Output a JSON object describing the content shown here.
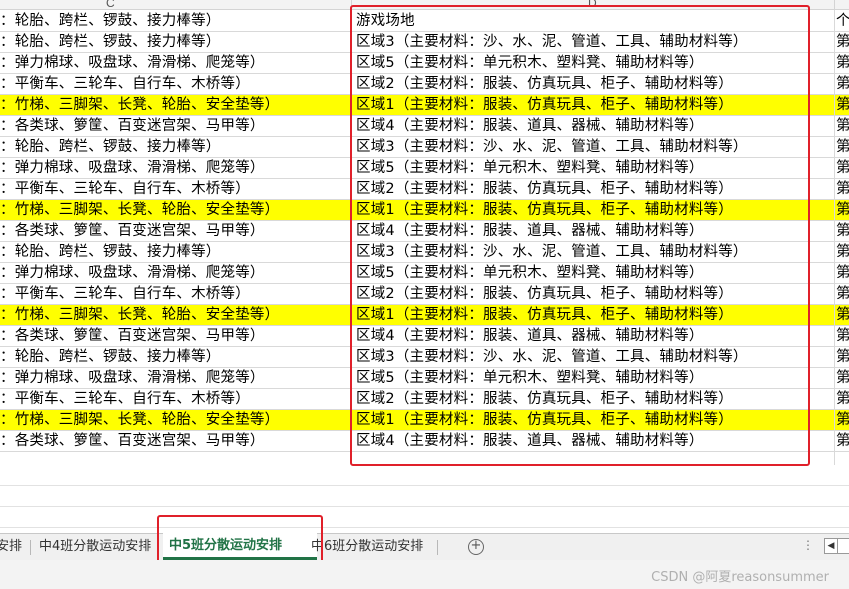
{
  "columns": {
    "c": "C",
    "d": "D"
  },
  "rows": [
    {
      "c": "：轮胎、跨栏、锣鼓、接力棒等）",
      "d": "游戏场地",
      "e": "个",
      "highlight": false
    },
    {
      "c": "：轮胎、跨栏、锣鼓、接力棒等）",
      "d": "区域3（主要材料：沙、水、泥、管道、工具、辅助材料等）",
      "e": "第",
      "highlight": false
    },
    {
      "c": "：弹力棉球、吸盘球、滑滑梯、爬笼等）",
      "d": "区域5（主要材料：单元积木、塑料凳、辅助材料等）",
      "e": "第",
      "highlight": false
    },
    {
      "c": "：平衡车、三轮车、自行车、木桥等）",
      "d": "区域2（主要材料：服装、仿真玩具、柜子、辅助材料等）",
      "e": "第",
      "highlight": false
    },
    {
      "c": "：竹梯、三脚架、长凳、轮胎、安全垫等）",
      "d": "区域1（主要材料：服装、仿真玩具、柜子、辅助材料等）",
      "e": "第",
      "highlight": true
    },
    {
      "c": "：各类球、箩筐、百变迷宫架、马甲等）",
      "d": "区域4（主要材料：服装、道具、器械、辅助材料等）",
      "e": "第",
      "highlight": false
    },
    {
      "c": "：轮胎、跨栏、锣鼓、接力棒等）",
      "d": "区域3（主要材料：沙、水、泥、管道、工具、辅助材料等）",
      "e": "第",
      "highlight": false
    },
    {
      "c": "：弹力棉球、吸盘球、滑滑梯、爬笼等）",
      "d": "区域5（主要材料：单元积木、塑料凳、辅助材料等）",
      "e": "第",
      "highlight": false
    },
    {
      "c": "：平衡车、三轮车、自行车、木桥等）",
      "d": "区域2（主要材料：服装、仿真玩具、柜子、辅助材料等）",
      "e": "第",
      "highlight": false
    },
    {
      "c": "：竹梯、三脚架、长凳、轮胎、安全垫等）",
      "d": "区域1（主要材料：服装、仿真玩具、柜子、辅助材料等）",
      "e": "第",
      "highlight": true
    },
    {
      "c": "：各类球、箩筐、百变迷宫架、马甲等）",
      "d": "区域4（主要材料：服装、道具、器械、辅助材料等）",
      "e": "第",
      "highlight": false
    },
    {
      "c": "：轮胎、跨栏、锣鼓、接力棒等）",
      "d": "区域3（主要材料：沙、水、泥、管道、工具、辅助材料等）",
      "e": "第",
      "highlight": false
    },
    {
      "c": "：弹力棉球、吸盘球、滑滑梯、爬笼等）",
      "d": "区域5（主要材料：单元积木、塑料凳、辅助材料等）",
      "e": "第",
      "highlight": false
    },
    {
      "c": "：平衡车、三轮车、自行车、木桥等）",
      "d": "区域2（主要材料：服装、仿真玩具、柜子、辅助材料等）",
      "e": "第",
      "highlight": false
    },
    {
      "c": "：竹梯、三脚架、长凳、轮胎、安全垫等）",
      "d": "区域1（主要材料：服装、仿真玩具、柜子、辅助材料等）",
      "e": "第",
      "highlight": true
    },
    {
      "c": "：各类球、箩筐、百变迷宫架、马甲等）",
      "d": "区域4（主要材料：服装、道具、器械、辅助材料等）",
      "e": "第",
      "highlight": false
    },
    {
      "c": "：轮胎、跨栏、锣鼓、接力棒等）",
      "d": "区域3（主要材料：沙、水、泥、管道、工具、辅助材料等）",
      "e": "第",
      "highlight": false
    },
    {
      "c": "：弹力棉球、吸盘球、滑滑梯、爬笼等）",
      "d": "区域5（主要材料：单元积木、塑料凳、辅助材料等）",
      "e": "第",
      "highlight": false
    },
    {
      "c": "：平衡车、三轮车、自行车、木桥等）",
      "d": "区域2（主要材料：服装、仿真玩具、柜子、辅助材料等）",
      "e": "第",
      "highlight": false
    },
    {
      "c": "：竹梯、三脚架、长凳、轮胎、安全垫等）",
      "d": "区域1（主要材料：服装、仿真玩具、柜子、辅助材料等）",
      "e": "第",
      "highlight": true
    },
    {
      "c": "：各类球、箩筐、百变迷宫架、马甲等）",
      "d": "区域4（主要材料：服装、道具、器械、辅助材料等）",
      "e": "第",
      "highlight": false
    }
  ],
  "sheet_tabs": [
    {
      "label": "安排",
      "active": false
    },
    {
      "label": "中4班分散运动安排",
      "active": false
    },
    {
      "label": "中5班分散运动安排",
      "active": true
    },
    {
      "label": "中6班分散运动安排",
      "active": false
    }
  ],
  "add_sheet_icon": "plus-circle-icon",
  "more_icon": "ellipsis-icon",
  "scroll_left_icon": "triangle-left-icon",
  "watermark": "CSDN @阿夏reasonsummer",
  "colors": {
    "highlight": "#ffff00",
    "annotation": "#e0202a",
    "active_tab": "#217346"
  }
}
